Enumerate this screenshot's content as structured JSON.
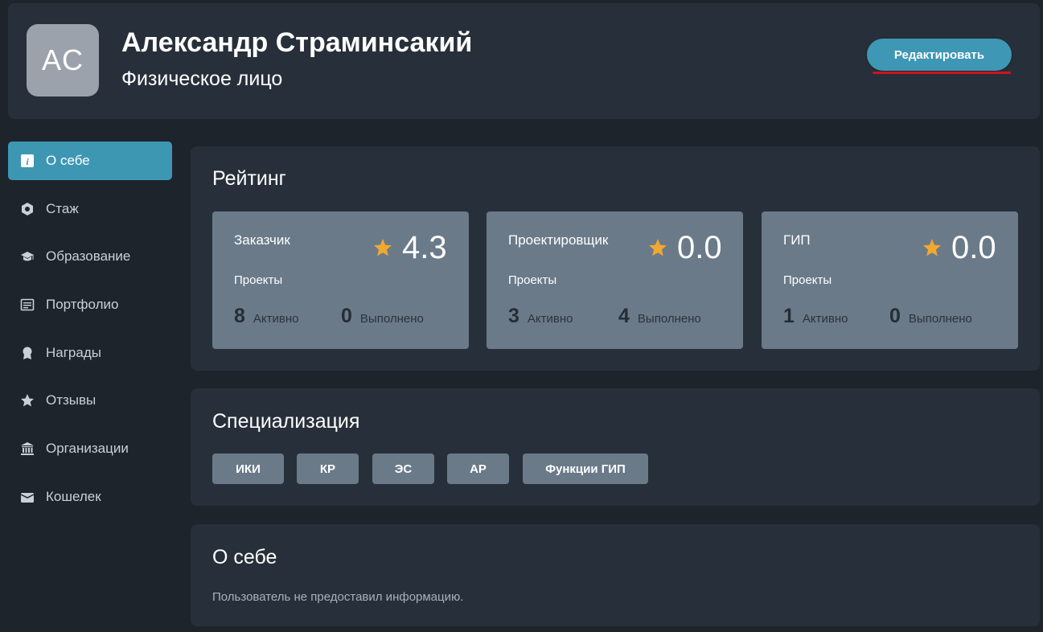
{
  "header": {
    "avatar_initials": "AC",
    "name": "Александр Страминсакий",
    "type": "Физическое лицо",
    "edit_label": "Редактировать"
  },
  "sidebar": {
    "items": [
      {
        "label": "О себе",
        "icon": "info-icon",
        "active": true
      },
      {
        "label": "Стаж",
        "icon": "hexagon-icon",
        "active": false
      },
      {
        "label": "Образование",
        "icon": "graduation-cap-icon",
        "active": false
      },
      {
        "label": "Портфолио",
        "icon": "document-icon",
        "active": false
      },
      {
        "label": "Награды",
        "icon": "award-icon",
        "active": false
      },
      {
        "label": "Отзывы",
        "icon": "star-icon",
        "active": false
      },
      {
        "label": "Организации",
        "icon": "bank-icon",
        "active": false
      },
      {
        "label": "Кошелек",
        "icon": "wallet-icon",
        "active": false
      }
    ]
  },
  "rating": {
    "title": "Рейтинг",
    "cards": [
      {
        "role": "Заказчик",
        "score": "4.3",
        "projects_label": "Проекты",
        "active": "8",
        "active_label": "Активно",
        "done": "0",
        "done_label": "Выполнено"
      },
      {
        "role": "Проектировщик",
        "score": "0.0",
        "projects_label": "Проекты",
        "active": "3",
        "active_label": "Активно",
        "done": "4",
        "done_label": "Выполнено"
      },
      {
        "role": "ГИП",
        "score": "0.0",
        "projects_label": "Проекты",
        "active": "1",
        "active_label": "Активно",
        "done": "0",
        "done_label": "Выполнено"
      }
    ]
  },
  "specialization": {
    "title": "Специализация",
    "tags": [
      "ИКИ",
      "КР",
      "ЭС",
      "АР",
      "Функции ГИП"
    ]
  },
  "about": {
    "title": "О себе",
    "text": "Пользователь не предоставил информацию."
  },
  "colors": {
    "accent": "#3d97b3",
    "star": "#f0a830",
    "card": "#6a7a89",
    "panel": "#27303a",
    "background": "#1d242b",
    "underline": "#d0131e"
  }
}
